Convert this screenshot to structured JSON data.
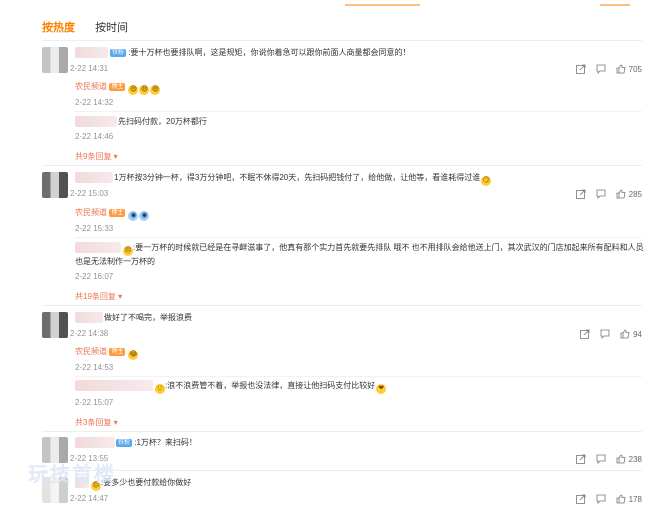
{
  "sort_tabs": {
    "hot": "按热度",
    "time": "按时间"
  },
  "comments": [
    {
      "text": ":要十万杯也要排队啊，这是规矩，你说你着急可以跟你前面人商量都会同意的！",
      "badge": "铁粉",
      "time": "2-22 14:31",
      "likes": "705",
      "replies": [
        {
          "name": "农民频道",
          "badge": "博主",
          "text": "",
          "emoji_count": 3,
          "time": "2-22 14:32"
        },
        {
          "name": "",
          "text": "先扫码付款，20万杯都行",
          "time": "2-22 14:46"
        }
      ],
      "more": "共9条回复"
    },
    {
      "text": "1万杯按3分钟一杯，得3万分钟吧，不眠不休得20天，先扫码把钱付了，给他做，让他等，看谁耗得过谁",
      "time": "2-22 15:03",
      "likes": "285",
      "replies": [
        {
          "name": "农民频道",
          "badge": "博主",
          "text": "",
          "time": "2-22 15:33"
        },
        {
          "name": "",
          "text": ":要一万杯的时候就已经是在寻衅滋事了，他真有那个实力首先就要先排队 哦不 也不用排队会给他送上门，其次武汉的门店加起来所有配料和人员",
          "text2": "也是无法制作一万杯的",
          "time": "2-22 16:07"
        }
      ],
      "more": "共19条回复"
    },
    {
      "text": "做好了不喝完，举报浪费",
      "time": "2-22 14:38",
      "likes": "94",
      "replies": [
        {
          "name": "农民频道",
          "badge": "博主",
          "text": "",
          "time": "2-22 14:53"
        },
        {
          "name": "",
          "text": ":浪不浪费管不着，举报也没法律，直接让他扫码支付比较好",
          "time": "2-22 15:07"
        }
      ],
      "more": "共3条回复"
    },
    {
      "text": ":1万杯？来扫码！",
      "badge": "铁粉",
      "time": "2-22 13:55",
      "likes": "238"
    },
    {
      "text": ":要多少也要付款给你做好",
      "time": "2-22 14:47",
      "likes": "178"
    }
  ],
  "watermark": "玩技首楼",
  "icons": [
    "share-icon",
    "comment-icon",
    "like-icon",
    "chevron-down-icon"
  ],
  "colors": {
    "accent": "#ff8200",
    "name": "#eb7350",
    "time": "#939393"
  }
}
